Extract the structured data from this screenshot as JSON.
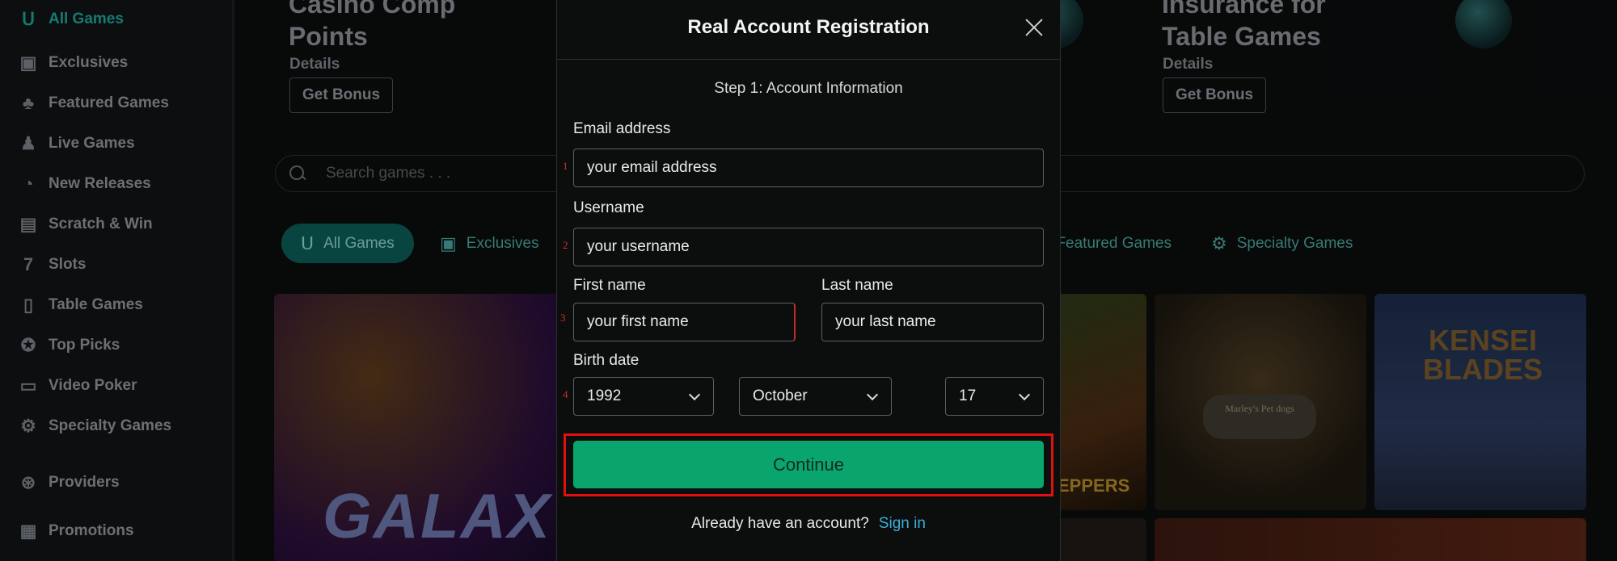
{
  "sidebar": {
    "items": [
      {
        "label": "All Games",
        "icon": "horseshoe-icon",
        "glyph": "Ս"
      },
      {
        "label": "Exclusives",
        "icon": "exclusive-badge-icon",
        "glyph": "▣"
      },
      {
        "label": "Featured Games",
        "icon": "clover-icon",
        "glyph": "♣"
      },
      {
        "label": "Live Games",
        "icon": "dealer-icon",
        "glyph": "♟"
      },
      {
        "label": "New Releases",
        "icon": "new-releases-icon",
        "glyph": "◔"
      },
      {
        "label": "Scratch & Win",
        "icon": "scratch-card-icon",
        "glyph": "▤"
      },
      {
        "label": "Slots",
        "icon": "seven-icon",
        "glyph": "7"
      },
      {
        "label": "Table Games",
        "icon": "cards-icon",
        "glyph": "▯"
      },
      {
        "label": "Top Picks",
        "icon": "award-icon",
        "glyph": "✪"
      },
      {
        "label": "Video Poker",
        "icon": "video-poker-icon",
        "glyph": "▭"
      },
      {
        "label": "Specialty Games",
        "icon": "gear-icon",
        "glyph": "⚙"
      },
      {
        "label": "Providers",
        "icon": "providers-icon",
        "glyph": "⊛"
      },
      {
        "label": "Promotions",
        "icon": "gift-icon",
        "glyph": "▦"
      }
    ]
  },
  "promos": [
    {
      "title_line1": "Casino Comp",
      "title_line2": "Points",
      "details": "Details",
      "button": "Get Bonus"
    },
    {
      "title_line1": "Insurance for",
      "title_line2": "Table Games",
      "details": "Details",
      "button": "Get Bonus"
    }
  ],
  "search": {
    "placeholder": "Search games . . ."
  },
  "categories": [
    {
      "label": "All Games",
      "glyph": "Ս"
    },
    {
      "label": "Exclusives",
      "glyph": "▣"
    },
    {
      "label": "Featured Games",
      "glyph": "♣"
    },
    {
      "label": "Specialty Games",
      "glyph": "⚙"
    }
  ],
  "tiles": {
    "galaxy": "GALAX",
    "peppers": "EPPERS",
    "marley": "Marley's Pet dogs",
    "kensei_line1": "KENSEI",
    "kensei_line2": "BLADES"
  },
  "modal": {
    "title": "Real Account Registration",
    "step": "Step 1: Account Information",
    "email_label": "Email address",
    "email_value": "your email address",
    "username_label": "Username",
    "username_value": "your username",
    "first_name_label": "First name",
    "first_name_value": "your first name",
    "last_name_label": "Last name",
    "last_name_value": "your last name",
    "birth_label": "Birth date",
    "birth_year": "1992",
    "birth_month": "October",
    "birth_day": "17",
    "continue_label": "Continue",
    "signin_prompt": "Already have an account?",
    "signin_link": "Sign in",
    "markers": [
      "1",
      "2",
      "3",
      "4"
    ]
  },
  "colors": {
    "accent": "#1ea39a",
    "continue_bg": "#0aa56d",
    "highlight": "#e01010",
    "link": "#3ab0d6"
  }
}
